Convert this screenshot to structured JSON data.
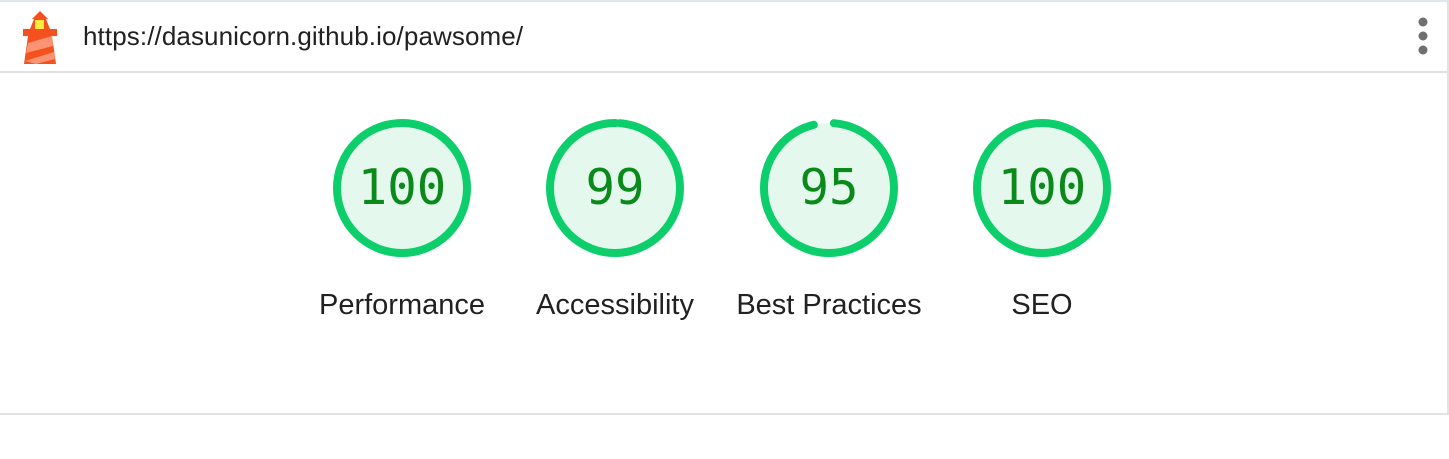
{
  "header": {
    "url": "https://dasunicorn.github.io/pawsome/",
    "logo_icon": "lighthouse-icon",
    "menu_icon": "more-vert-icon"
  },
  "colors": {
    "pass_stroke": "#0cce6b",
    "pass_fill": "#e5f8ee",
    "pass_text": "#0a8a1a",
    "divider": "#e2e2e2"
  },
  "gauges": [
    {
      "id": "performance",
      "score": 100,
      "label": "Performance"
    },
    {
      "id": "accessibility",
      "score": 99,
      "label": "Accessibility"
    },
    {
      "id": "best-practices",
      "score": 95,
      "label": "Best Practices"
    },
    {
      "id": "seo",
      "score": 100,
      "label": "SEO"
    }
  ]
}
